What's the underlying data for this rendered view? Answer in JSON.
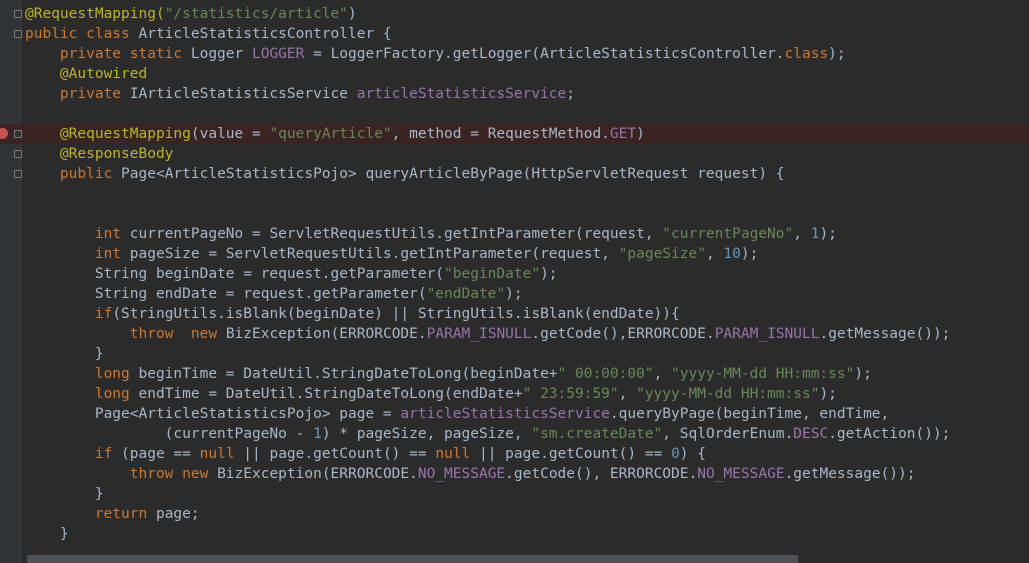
{
  "lines": [
    [
      {
        "t": "@RequestMapping(",
        "c": "ann"
      },
      {
        "t": "\"/statistics/article\"",
        "c": "str"
      },
      {
        "t": ")"
      }
    ],
    [
      {
        "t": "public class",
        "c": "kw"
      },
      {
        "t": " ArticleStatisticsController {"
      }
    ],
    [
      {
        "t": "    "
      },
      {
        "t": "private static",
        "c": "kw"
      },
      {
        "t": " Logger "
      },
      {
        "t": "LOGGER",
        "c": "fld"
      },
      {
        "t": " = LoggerFactory.getLogger(ArticleStatisticsController."
      },
      {
        "t": "class",
        "c": "kw"
      },
      {
        "t": ");"
      }
    ],
    [
      {
        "t": "    "
      },
      {
        "t": "@Autowired",
        "c": "ann"
      }
    ],
    [
      {
        "t": "    "
      },
      {
        "t": "private",
        "c": "kw"
      },
      {
        "t": " IArticleStatisticsService "
      },
      {
        "t": "articleStatisticsService",
        "c": "fld"
      },
      {
        "t": ";"
      }
    ],
    [],
    [
      {
        "t": "    "
      },
      {
        "t": "@RequestMapping",
        "c": "ann"
      },
      {
        "t": "(value = "
      },
      {
        "t": "\"queryArticle\"",
        "c": "str"
      },
      {
        "t": ", method = RequestMethod."
      },
      {
        "t": "GET",
        "c": "fld"
      },
      {
        "t": ")"
      }
    ],
    [
      {
        "t": "    "
      },
      {
        "t": "@ResponseBody",
        "c": "ann"
      }
    ],
    [
      {
        "t": "    "
      },
      {
        "t": "public",
        "c": "kw"
      },
      {
        "t": " Page<ArticleStatisticsPojo> queryArticleByPage(HttpServletRequest request) {"
      }
    ],
    [],
    [],
    [
      {
        "t": "        "
      },
      {
        "t": "int",
        "c": "kw"
      },
      {
        "t": " currentPageNo = ServletRequestUtils.getIntParameter(request, "
      },
      {
        "t": "\"currentPageNo\"",
        "c": "str"
      },
      {
        "t": ", "
      },
      {
        "t": "1",
        "c": "num"
      },
      {
        "t": ");"
      }
    ],
    [
      {
        "t": "        "
      },
      {
        "t": "int",
        "c": "kw"
      },
      {
        "t": " pageSize = ServletRequestUtils.getIntParameter(request, "
      },
      {
        "t": "\"pageSize\"",
        "c": "str"
      },
      {
        "t": ", "
      },
      {
        "t": "10",
        "c": "num"
      },
      {
        "t": ");"
      }
    ],
    [
      {
        "t": "        String beginDate = request.getParameter("
      },
      {
        "t": "\"beginDate\"",
        "c": "str"
      },
      {
        "t": ");"
      }
    ],
    [
      {
        "t": "        String endDate = request.getParameter("
      },
      {
        "t": "\"endDate\"",
        "c": "str"
      },
      {
        "t": ");"
      }
    ],
    [
      {
        "t": "        "
      },
      {
        "t": "if",
        "c": "kw"
      },
      {
        "t": "(StringUtils.isBlank(beginDate) || StringUtils.isBlank(endDate)){"
      }
    ],
    [
      {
        "t": "            "
      },
      {
        "t": "throw",
        "c": "kw"
      },
      {
        "t": "  "
      },
      {
        "t": "new",
        "c": "kw"
      },
      {
        "t": " BizException(ERRORCODE."
      },
      {
        "t": "PARAM_ISNULL",
        "c": "fld"
      },
      {
        "t": ".getCode(),ERRORCODE."
      },
      {
        "t": "PARAM_ISNULL",
        "c": "fld"
      },
      {
        "t": ".getMessage());"
      }
    ],
    [
      {
        "t": "        }"
      }
    ],
    [
      {
        "t": "        "
      },
      {
        "t": "long",
        "c": "kw"
      },
      {
        "t": " beginTime = DateUtil.StringDateToLong(beginDate+"
      },
      {
        "t": "\" 00:00:00\"",
        "c": "str"
      },
      {
        "t": ", "
      },
      {
        "t": "\"yyyy-MM-dd HH:mm:ss\"",
        "c": "str"
      },
      {
        "t": ");"
      }
    ],
    [
      {
        "t": "        "
      },
      {
        "t": "long",
        "c": "kw"
      },
      {
        "t": " endTime = DateUtil.StringDateToLong(endDate+"
      },
      {
        "t": "\" 23:59:59\"",
        "c": "str"
      },
      {
        "t": ", "
      },
      {
        "t": "\"yyyy-MM-dd HH:mm:ss\"",
        "c": "str"
      },
      {
        "t": ");"
      }
    ],
    [
      {
        "t": "        Page<ArticleStatisticsPojo> page = "
      },
      {
        "t": "articleStatisticsService",
        "c": "fld"
      },
      {
        "t": ".queryByPage(beginTime, endTime,"
      }
    ],
    [
      {
        "t": "                (currentPageNo - "
      },
      {
        "t": "1",
        "c": "num"
      },
      {
        "t": ") * pageSize, pageSize, "
      },
      {
        "t": "\"sm.createDate\"",
        "c": "str"
      },
      {
        "t": ", SqlOrderEnum."
      },
      {
        "t": "DESC",
        "c": "fld"
      },
      {
        "t": ".getAction());"
      }
    ],
    [
      {
        "t": "        "
      },
      {
        "t": "if",
        "c": "kw"
      },
      {
        "t": " (page == "
      },
      {
        "t": "null",
        "c": "kw"
      },
      {
        "t": " || page.getCount() == "
      },
      {
        "t": "null",
        "c": "kw"
      },
      {
        "t": " || page.getCount() == "
      },
      {
        "t": "0",
        "c": "num"
      },
      {
        "t": ") {"
      }
    ],
    [
      {
        "t": "            "
      },
      {
        "t": "throw new",
        "c": "kw"
      },
      {
        "t": " BizException(ERRORCODE."
      },
      {
        "t": "NO_MESSAGE",
        "c": "fld"
      },
      {
        "t": ".getCode(), ERRORCODE."
      },
      {
        "t": "NO_MESSAGE",
        "c": "fld"
      },
      {
        "t": ".getMessage());"
      }
    ],
    [
      {
        "t": "        }"
      }
    ],
    [
      {
        "t": "        "
      },
      {
        "t": "return",
        "c": "kw"
      },
      {
        "t": " page;"
      }
    ],
    [
      {
        "t": "    }"
      }
    ]
  ],
  "breakpoint_line": 6,
  "fold_lines": [
    0,
    1,
    6,
    7,
    8
  ]
}
